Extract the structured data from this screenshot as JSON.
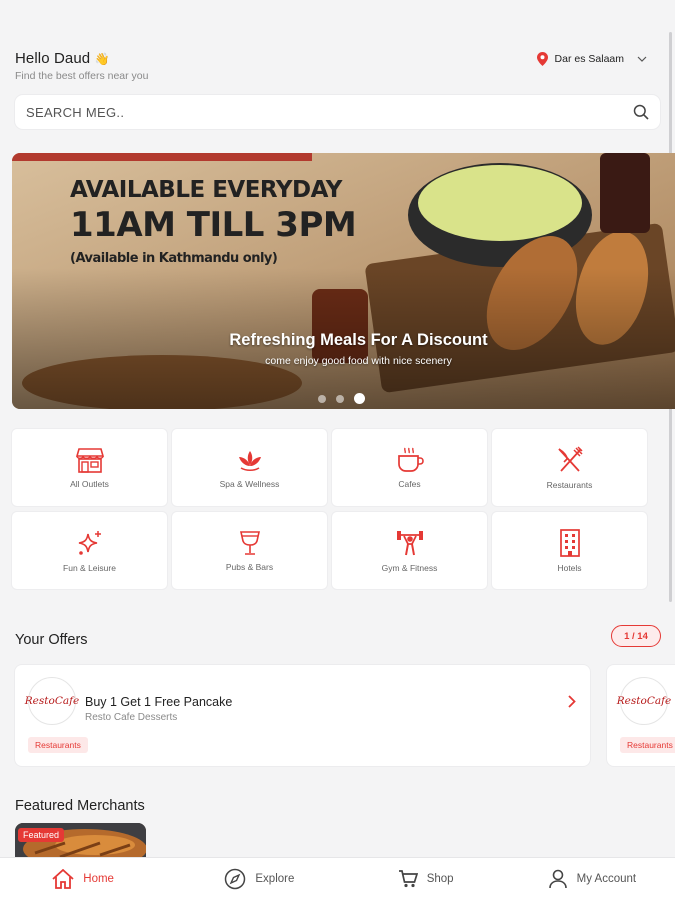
{
  "colors": {
    "accent": "#e53935",
    "background": "#f4f4f5",
    "card": "#ffffff"
  },
  "header": {
    "greeting": "Hello Daud",
    "greeting_emoji": "👋",
    "subtitle": "Find the best offers near you",
    "location": "Dar es Salaam",
    "location_icon": "location-pin-icon",
    "dropdown_icon": "chevron-down-icon"
  },
  "search": {
    "placeholder": "SEARCH MEG..",
    "icon": "search-icon"
  },
  "banner": {
    "promo_line_1": "AVAILABLE EVERYDAY",
    "promo_line_2": "11AM TILL 3PM",
    "promo_line_3": "(Available in Kathmandu only)",
    "title": "Refreshing Meals For A Discount",
    "subtitle": "come enjoy good food with nice scenery",
    "slide_count": 3,
    "active_slide": 3
  },
  "categories": [
    {
      "label": "All Outlets",
      "icon": "storefront-icon"
    },
    {
      "label": "Spa & Wellness",
      "icon": "lotus-icon"
    },
    {
      "label": "Cafes",
      "icon": "coffee-cup-icon"
    },
    {
      "label": "Restaurants",
      "icon": "fork-knife-icon"
    },
    {
      "label": "Fun & Leisure",
      "icon": "sparkles-icon"
    },
    {
      "label": "Pubs & Bars",
      "icon": "cocktail-glass-icon"
    },
    {
      "label": "Gym & Fitness",
      "icon": "weightlifter-icon"
    },
    {
      "label": "Hotels",
      "icon": "building-icon"
    }
  ],
  "offers": {
    "section_title": "Your Offers",
    "pagination": "1 / 14",
    "items": [
      {
        "logo_text": "RestoCafe",
        "title": "Buy 1 Get 1 Free Pancake",
        "merchant": "Resto Cafe Desserts",
        "tag": "Restaurants"
      },
      {
        "logo_text": "RestoCafe",
        "title": "",
        "merchant": "",
        "tag": "Restaurants"
      }
    ]
  },
  "featured": {
    "section_title": "Featured Merchants",
    "badge": "Featured"
  },
  "bottom_nav": [
    {
      "label": "Home",
      "icon": "home-icon",
      "active": true
    },
    {
      "label": "Explore",
      "icon": "compass-icon",
      "active": false
    },
    {
      "label": "Shop",
      "icon": "cart-icon",
      "active": false
    },
    {
      "label": "My Account",
      "icon": "user-icon",
      "active": false
    }
  ]
}
